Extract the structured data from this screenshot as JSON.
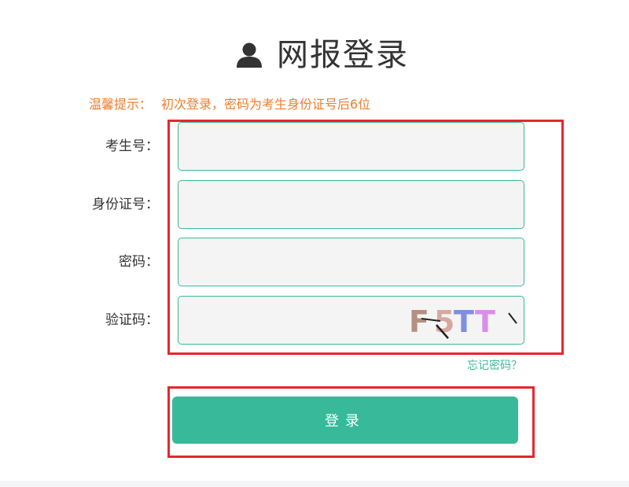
{
  "header": {
    "title": "网报登录",
    "icon": "user-icon"
  },
  "tip": {
    "label": "温馨提示：",
    "text": "初次登录，密码为考生身份证号后6位"
  },
  "form": {
    "fields": [
      {
        "label": "考生号：",
        "value": "",
        "placeholder": ""
      },
      {
        "label": "身份证号：",
        "value": "",
        "placeholder": ""
      },
      {
        "label": "密码：",
        "value": "",
        "placeholder": ""
      },
      {
        "label": "验证码：",
        "value": "",
        "placeholder": ""
      }
    ],
    "captcha_text": "F5TT",
    "forgot_link": "忘记密码？",
    "submit_label": "登录"
  },
  "colors": {
    "accent": "#37b99a",
    "tip": "#ef7d2d",
    "highlight": "#e8262d",
    "input_border": "#3fb898",
    "input_bg": "#f4f4f4"
  }
}
